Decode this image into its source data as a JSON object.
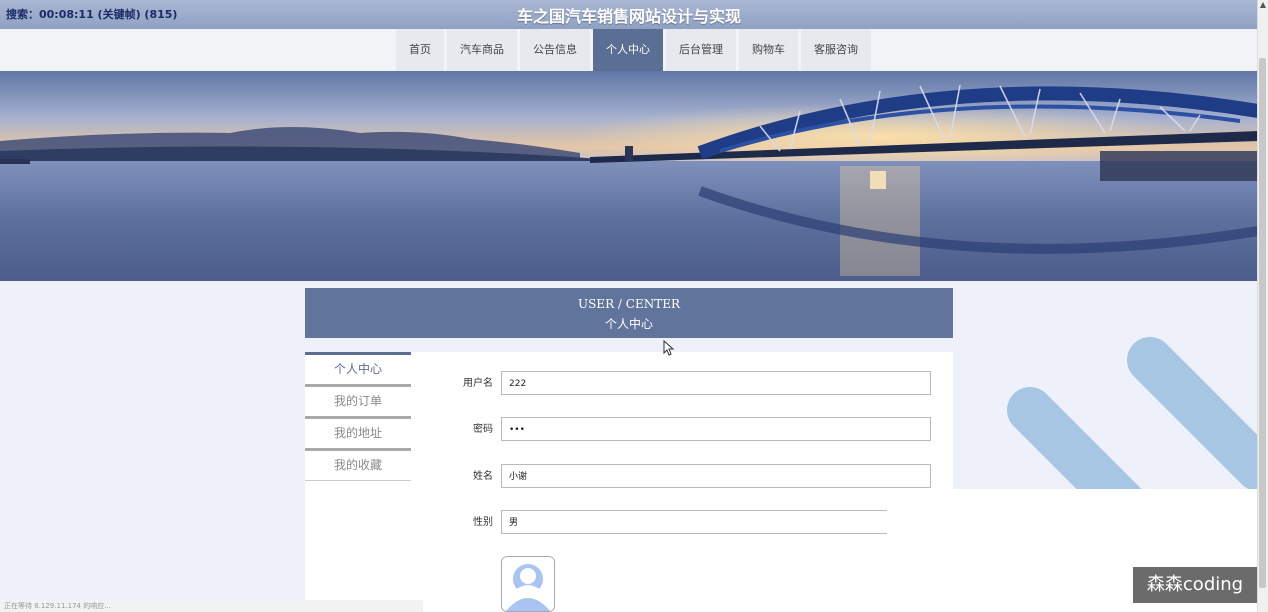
{
  "recorder": {
    "text": "搜索：00:08:11 (关键帧) (815)"
  },
  "site": {
    "title": "车之国汽车销售网站设计与实现"
  },
  "nav": {
    "items": [
      {
        "label": "首页"
      },
      {
        "label": "汽车商品"
      },
      {
        "label": "公告信息"
      },
      {
        "label": "个人中心"
      },
      {
        "label": "后台管理"
      },
      {
        "label": "购物车"
      },
      {
        "label": "客服咨询"
      }
    ],
    "active_index": 3
  },
  "center": {
    "title_en": "USER / CENTER",
    "title_cn": "个人中心"
  },
  "sidebar": {
    "items": [
      {
        "label": "个人中心"
      },
      {
        "label": "我的订单"
      },
      {
        "label": "我的地址"
      },
      {
        "label": "我的收藏"
      }
    ]
  },
  "form": {
    "username": {
      "label": "用户名",
      "value": "222"
    },
    "password": {
      "label": "密码",
      "value": "•••"
    },
    "name": {
      "label": "姓名",
      "value": "小谢"
    },
    "gender": {
      "label": "性别",
      "value": "男"
    }
  },
  "status": {
    "text": "正在等待 8.129.11.174 的响应..."
  },
  "watermark": {
    "text": "森森coding"
  },
  "colors": {
    "accent": "#5b6f95",
    "header_bar": "#61759c",
    "deco_blue": "#a7c6e4"
  }
}
